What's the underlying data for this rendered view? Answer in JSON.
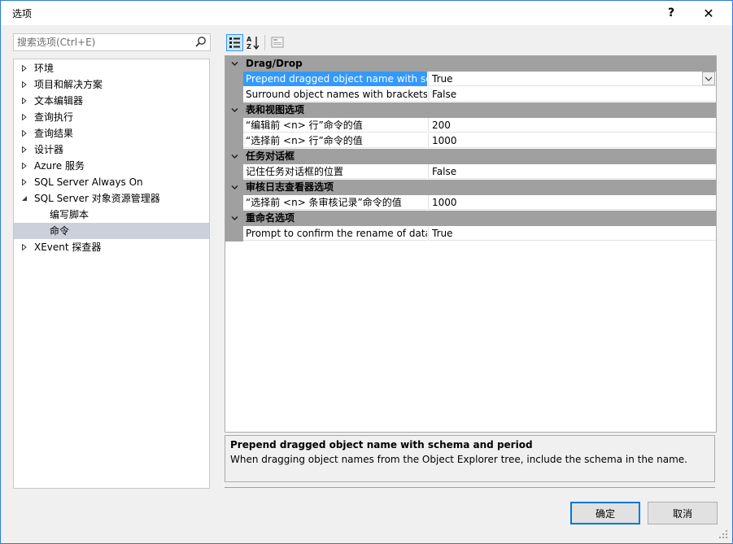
{
  "window": {
    "title": "选项",
    "help_label": "?",
    "close_label": "✕"
  },
  "search": {
    "placeholder": "搜索选项(Ctrl+E)",
    "icon": "search-icon"
  },
  "tree": {
    "items": [
      {
        "label": "环境",
        "expandable": true,
        "expanded": false,
        "level": 0
      },
      {
        "label": "项目和解决方案",
        "expandable": true,
        "expanded": false,
        "level": 0
      },
      {
        "label": "文本编辑器",
        "expandable": true,
        "expanded": false,
        "level": 0
      },
      {
        "label": "查询执行",
        "expandable": true,
        "expanded": false,
        "level": 0
      },
      {
        "label": "查询结果",
        "expandable": true,
        "expanded": false,
        "level": 0
      },
      {
        "label": "设计器",
        "expandable": true,
        "expanded": false,
        "level": 0
      },
      {
        "label": "Azure 服务",
        "expandable": true,
        "expanded": false,
        "level": 0
      },
      {
        "label": "SQL Server Always On",
        "expandable": true,
        "expanded": false,
        "level": 0
      },
      {
        "label": "SQL Server 对象资源管理器",
        "expandable": true,
        "expanded": true,
        "level": 0
      },
      {
        "label": "编写脚本",
        "expandable": false,
        "level": 1
      },
      {
        "label": "命令",
        "expandable": false,
        "level": 1,
        "selected": true
      },
      {
        "label": "XEvent 探查器",
        "expandable": true,
        "expanded": false,
        "level": 0
      }
    ]
  },
  "toolbar": {
    "categorized": "categorized-view-icon",
    "alphabetical": "alphabetical-sort-icon",
    "property_pages": "property-pages-icon"
  },
  "grid": {
    "categories": [
      {
        "label": "Drag/Drop",
        "properties": [
          {
            "name": "Prepend dragged object name with schema and period",
            "value": "True",
            "selected": true,
            "dropdown": true
          },
          {
            "name": "Surround object names with brackets when dragged",
            "value": "False"
          }
        ]
      },
      {
        "label": "表和视图选项",
        "properties": [
          {
            "name": "“编辑前 <n> 行”命令的值",
            "value": "200"
          },
          {
            "name": "“选择前 <n> 行”命令的值",
            "value": "1000"
          }
        ]
      },
      {
        "label": "任务对话框",
        "properties": [
          {
            "name": "记住任务对话框的位置",
            "value": "False"
          }
        ]
      },
      {
        "label": "审核日志查看器选项",
        "properties": [
          {
            "name": "“选择前 <n> 条审核记录”命令的值",
            "value": "1000"
          }
        ]
      },
      {
        "label": "重命名选项",
        "properties": [
          {
            "name": "Prompt to confirm the rename of database objects",
            "value": "True"
          }
        ]
      }
    ]
  },
  "description": {
    "title": "Prepend dragged object name with schema and period",
    "text": "When dragging object names from the Object Explorer tree, include the schema in the name."
  },
  "buttons": {
    "ok": "确定",
    "cancel": "取消"
  },
  "colors": {
    "accent": "#0078d7",
    "selection": "#3399ff",
    "category_bg": "#a0a0a0",
    "tree_selected": "#ccd0da"
  }
}
